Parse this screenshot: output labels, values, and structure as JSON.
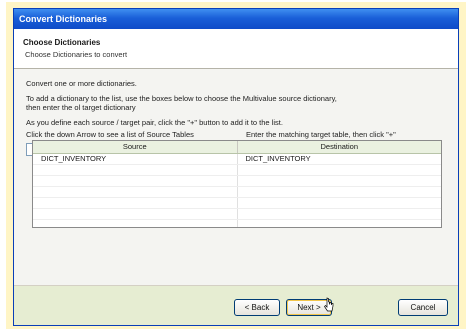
{
  "window": {
    "title": "Convert Dictionaries"
  },
  "header": {
    "title": "Choose Dictionaries",
    "subtitle": "Choose Dictionaries to convert"
  },
  "body": {
    "line1": "Convert one or more dictionaries.",
    "line2a": "To add a dictionary to the list, use the boxes below to choose the Multivalue source dictionary,",
    "line2b": "then enter the ol target dictionary",
    "line3": "As you define each source / target pair, click the \"+\" button to add it to the list.",
    "source_label": "Click the down Arrow to see a list of Source Tables",
    "target_label": "Enter the matching target table, then click \"+\"",
    "source_value": "",
    "target_value": "",
    "add_button": "+"
  },
  "grid": {
    "columns": [
      "Source",
      "Destination"
    ],
    "rows": [
      [
        "DICT_INVENTORY",
        "DICT_INVENTORY"
      ]
    ]
  },
  "footer": {
    "back": "< Back",
    "next": "Next >",
    "cancel": "Cancel"
  },
  "colors": {
    "titlebar": "#1a5fd8",
    "footer": "#e6edd2",
    "frame": "#fff5c6"
  }
}
